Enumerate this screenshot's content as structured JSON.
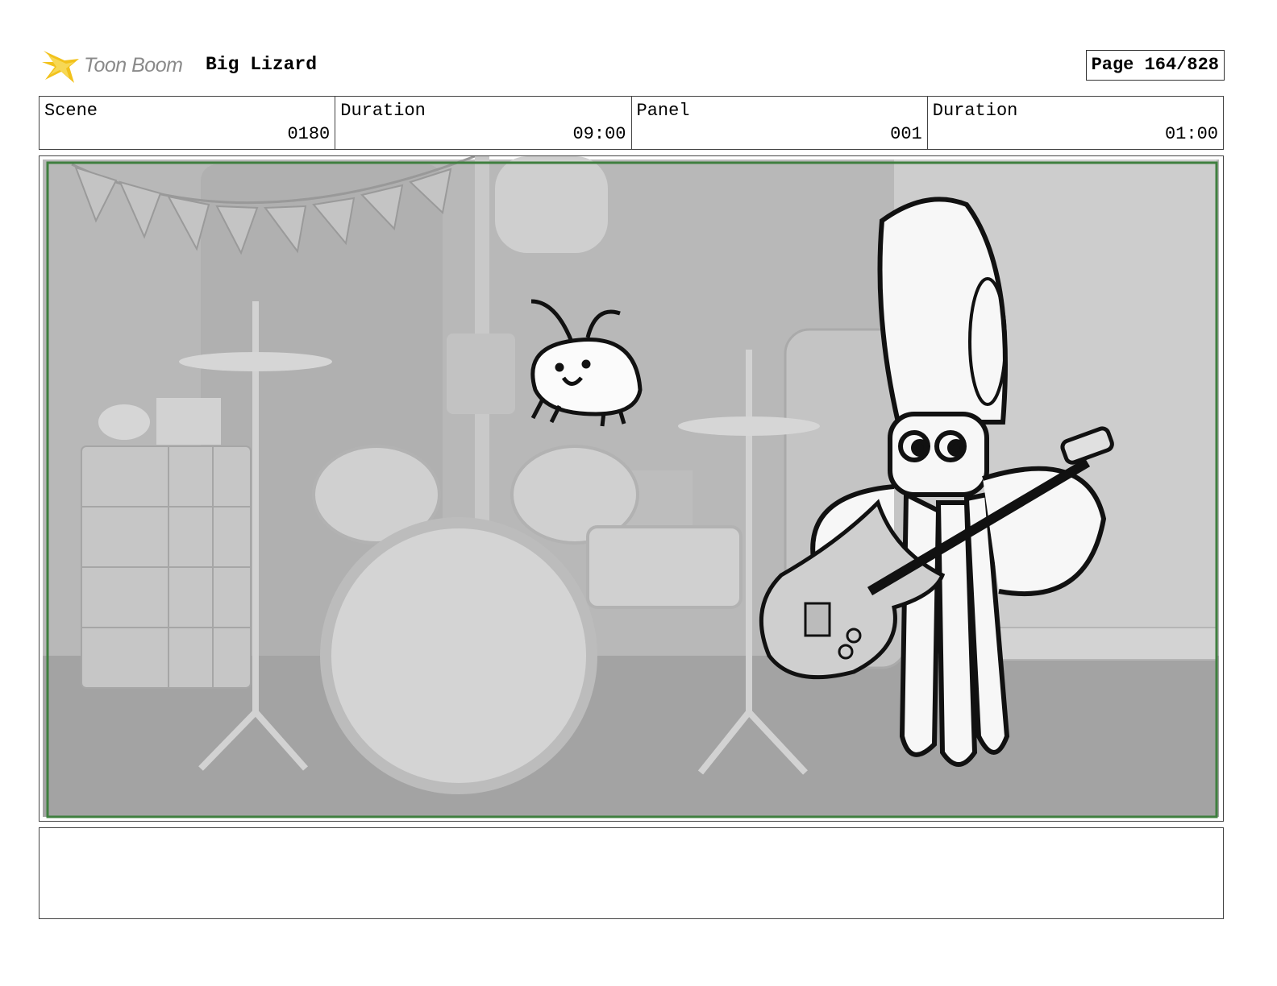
{
  "header": {
    "logo_text": "Toon Boom",
    "project_title": "Big Lizard",
    "page_label": "Page 164/828"
  },
  "info": {
    "scene_label": "Scene",
    "scene_value": "0180",
    "scene_duration_label": "Duration",
    "scene_duration_value": "09:00",
    "panel_label": "Panel",
    "panel_value": "001",
    "panel_duration_label": "Duration",
    "panel_duration_value": "01:00"
  },
  "notes": {
    "text": ""
  },
  "colors": {
    "safe_frame": "#3f7f3f",
    "logo_yellow": "#f2c21b",
    "background_gray": "#b4b4b4"
  }
}
